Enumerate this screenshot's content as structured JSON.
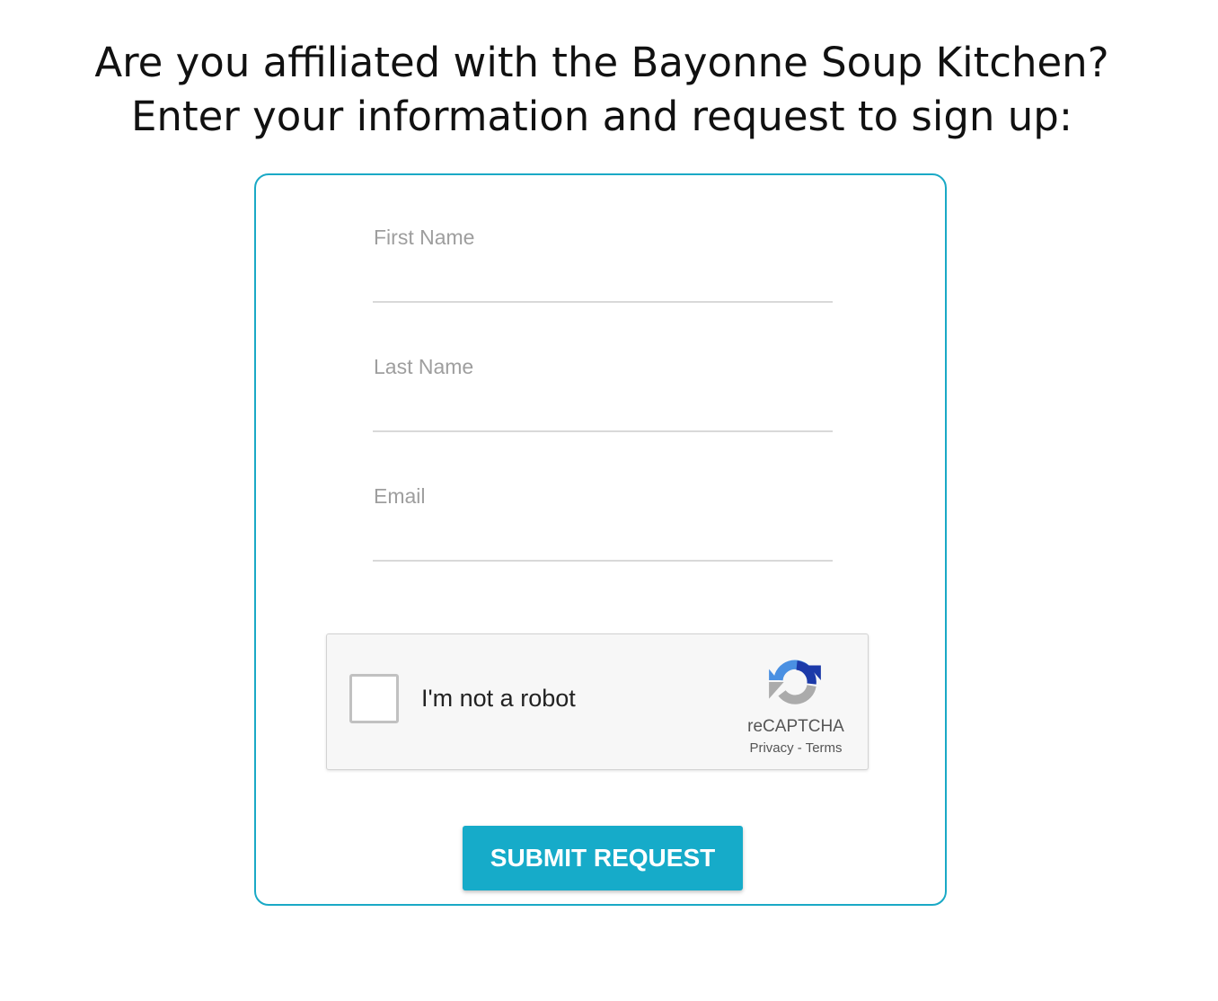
{
  "heading": {
    "line1": "Are you affiliated with the Bayonne Soup Kitchen?",
    "line2": "Enter your information and request to sign up:"
  },
  "form": {
    "first_name": {
      "label": "First Name",
      "value": ""
    },
    "last_name": {
      "label": "Last Name",
      "value": ""
    },
    "email": {
      "label": "Email",
      "value": ""
    },
    "submit_label": "SUBMIT REQUEST"
  },
  "recaptcha": {
    "checkbox_label": "I'm not a robot",
    "checked": false,
    "brand": "reCAPTCHA",
    "privacy": "Privacy",
    "separator": " - ",
    "terms": "Terms",
    "icon": "recaptcha-logo-icon"
  },
  "colors": {
    "accent": "#16abc9",
    "border": "#1aa9c6",
    "label": "#9e9e9e"
  }
}
